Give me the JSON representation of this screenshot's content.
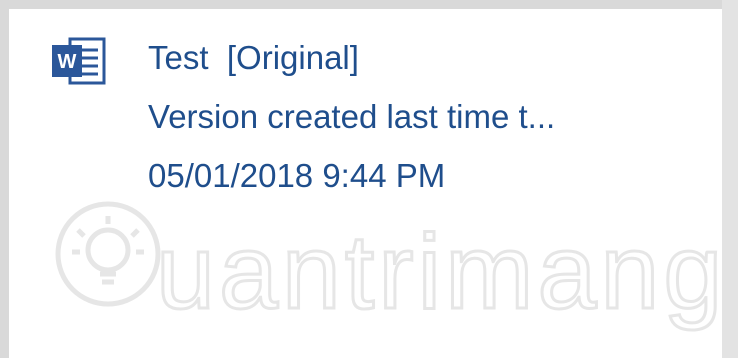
{
  "version": {
    "document_name": "Test",
    "version_tag": "[Original]",
    "description": "Version created last time t...",
    "timestamp": "05/01/2018 9:44 PM",
    "icon": "word-document-icon"
  },
  "watermark": {
    "text": "uantrimang",
    "icon": "lightbulb-logo-icon"
  },
  "colors": {
    "text": "#1f4e8c",
    "word_blue": "#2b579a",
    "border": "#d9d9d9",
    "watermark": "#ececec"
  }
}
